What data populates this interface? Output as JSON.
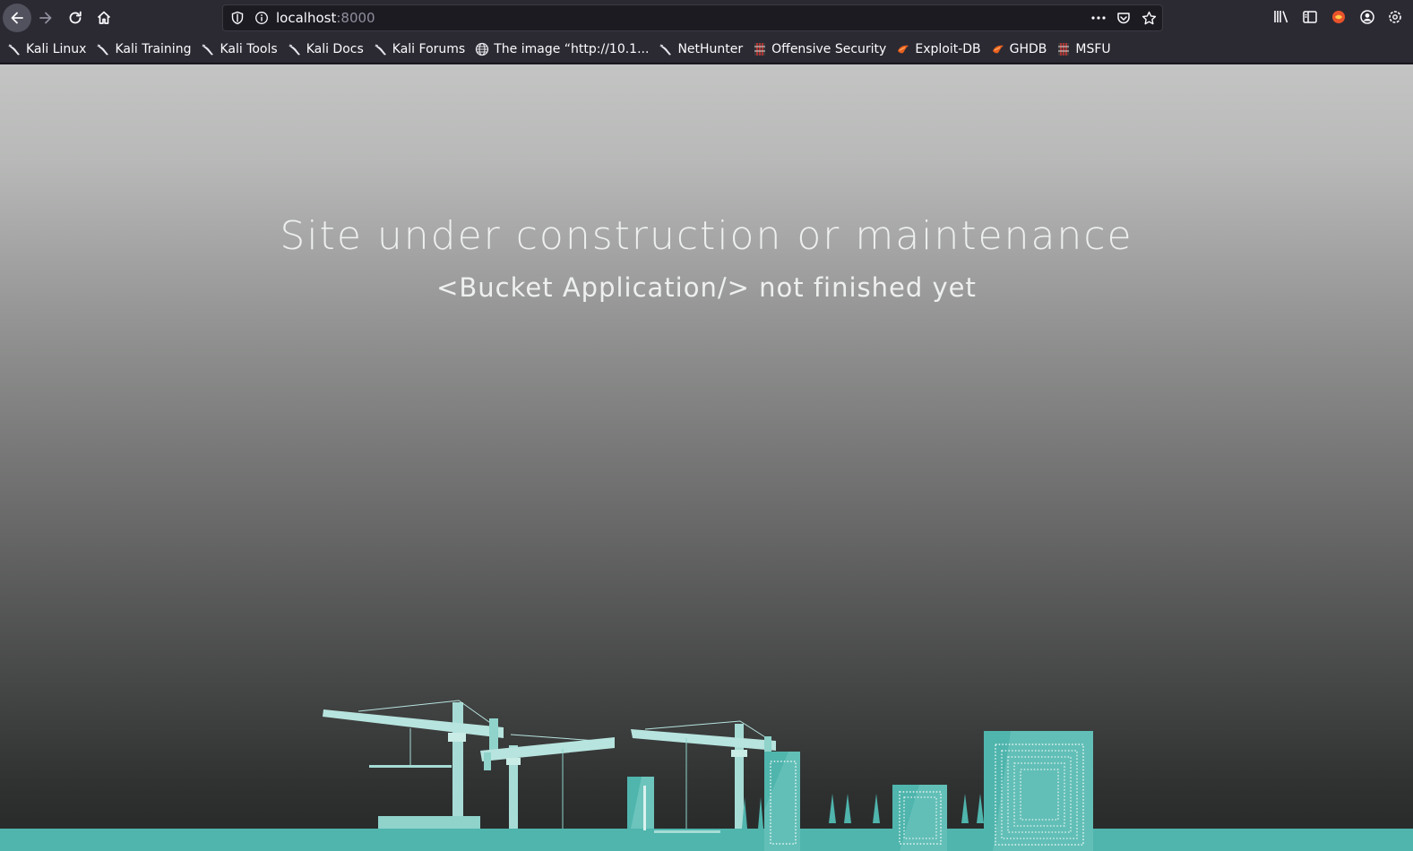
{
  "toolbar": {
    "url_host": "localhost",
    "url_port": ":8000"
  },
  "bookmarks": [
    {
      "label": "Kali Linux",
      "icon": "kali-dragon-icon"
    },
    {
      "label": "Kali Training",
      "icon": "kali-dragon-icon"
    },
    {
      "label": "Kali Tools",
      "icon": "kali-dragon-icon"
    },
    {
      "label": "Kali Docs",
      "icon": "kali-dragon-icon"
    },
    {
      "label": "Kali Forums",
      "icon": "kali-dragon-icon"
    },
    {
      "label": "The image “http://10.1...",
      "icon": "globe-icon"
    },
    {
      "label": "NetHunter",
      "icon": "kali-dragon-icon"
    },
    {
      "label": "Offensive Security",
      "icon": "offsec-icon"
    },
    {
      "label": "Exploit-DB",
      "icon": "exploitdb-icon"
    },
    {
      "label": "GHDB",
      "icon": "exploitdb-icon"
    },
    {
      "label": "MSFU",
      "icon": "offsec-icon"
    }
  ],
  "page": {
    "headline": "Site under construction or maintenance",
    "subline": "<Bucket Application/> not finished yet"
  },
  "colors": {
    "accent": "#4fb5ad",
    "chrome": "#2b2a33"
  }
}
